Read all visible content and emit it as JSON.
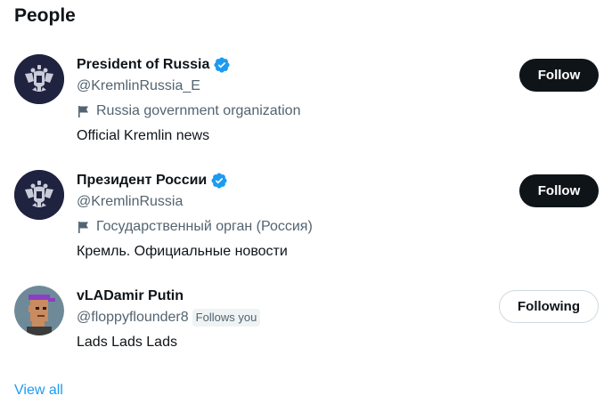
{
  "section": {
    "title": "People"
  },
  "people": [
    {
      "display_name": "President of Russia",
      "verified": true,
      "handle": "@KremlinRussia_E",
      "label": "Russia government organization",
      "bio": "Official Kremlin news",
      "button_label": "Follow",
      "avatar_icon": "double-headed-eagle-emblem"
    },
    {
      "display_name": "Президент России",
      "verified": true,
      "handle": "@KremlinRussia",
      "label": "Государственный орган (Россия)",
      "bio": "Кремль. Официальные новости",
      "button_label": "Follow",
      "avatar_icon": "double-headed-eagle-emblem"
    },
    {
      "display_name": "vLADamir Putin",
      "verified": false,
      "handle": "@floppyflounder8",
      "follows_you": "Follows you",
      "bio": "Lads Lads Lads",
      "button_label": "Following",
      "avatar_icon": "pixel-punk-avatar"
    }
  ],
  "footer": {
    "view_all": "View all"
  },
  "colors": {
    "text_primary": "#0f1419",
    "text_secondary": "#536471",
    "link": "#1d9bf0",
    "verified_badge": "#1d9bf0",
    "button_dark": "#0f1419"
  }
}
